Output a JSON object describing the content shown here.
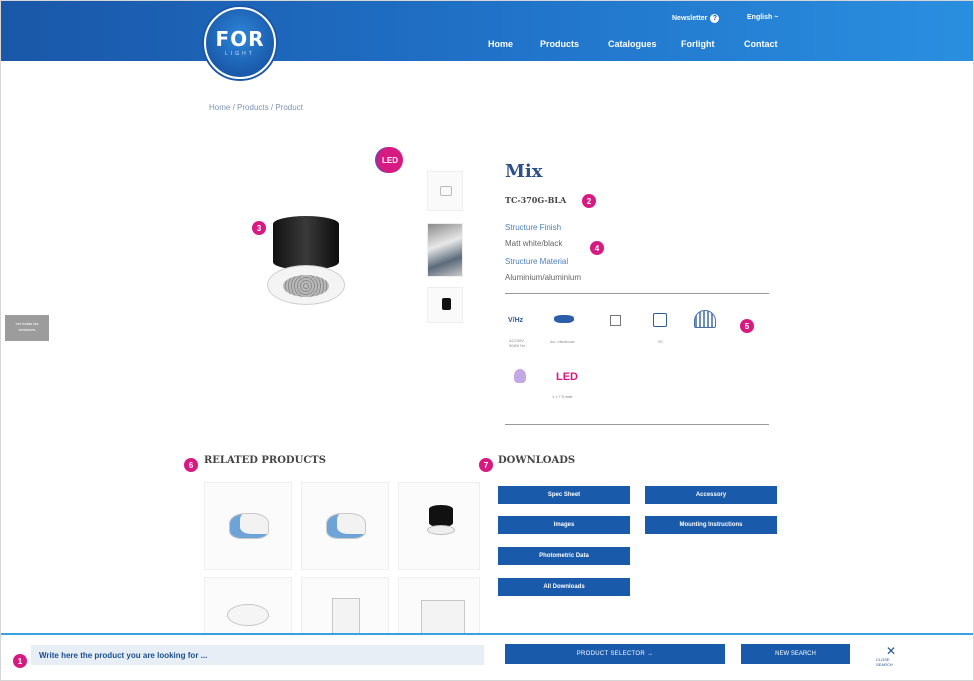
{
  "header": {
    "logo_text": "FOR",
    "logo_sub": "LIGHT",
    "newsletter_label": "Newsletter",
    "language_label": "English ~",
    "nav": [
      "Home",
      "Products",
      "Catalogues",
      "Forlight",
      "Contact"
    ]
  },
  "breadcrumb": [
    "Home",
    "/",
    "Products",
    "/",
    "Product"
  ],
  "product": {
    "led_badge": "LED",
    "title": "Mix",
    "code": "TC-370G-BLA",
    "specs": [
      {
        "key": "Structure Finish",
        "value": "Matt white/black"
      },
      {
        "key": "Structure Material",
        "value": "Aluminium/aluminium"
      }
    ],
    "icons": [
      {
        "name": "voltage-hz-icon",
        "text": "V/Hz",
        "label": "AC230V\n50/60 Hz"
      },
      {
        "name": "driver-icon",
        "text": "",
        "label": "Inc. electronic"
      },
      {
        "name": "class-icon",
        "text": "",
        "label": ""
      },
      {
        "name": "ip-icon",
        "text": "",
        "label": "20"
      },
      {
        "name": "dome-icon",
        "text": "",
        "label": ""
      },
      {
        "name": "bulb-icon",
        "text": "",
        "label": ""
      },
      {
        "name": "led-icon",
        "text": "LED",
        "label": "1 x 7.5 watt"
      }
    ]
  },
  "side_tab": "ver todas las versiones",
  "related": {
    "heading": "RELATED PRODUCTS"
  },
  "downloads": {
    "heading": "DOWNLOADS",
    "buttons": [
      "Spec Sheet",
      "Accessory",
      "Images",
      "Mounting Instructions",
      "Photometric Data",
      "All Downloads"
    ]
  },
  "markers": [
    "1",
    "2",
    "3",
    "4",
    "5",
    "6",
    "7"
  ],
  "search_bar": {
    "placeholder": "Write here the product you are looking for ...",
    "selector_label": "PRODUCT SELECTOR →",
    "new_search_label": "NEW SEARCH",
    "close_label": "CLOSE SEARCH"
  },
  "colors": {
    "brand_blue": "#1a5aab",
    "accent_magenta": "#d61a82",
    "link_blue": "#4a7fbf"
  }
}
